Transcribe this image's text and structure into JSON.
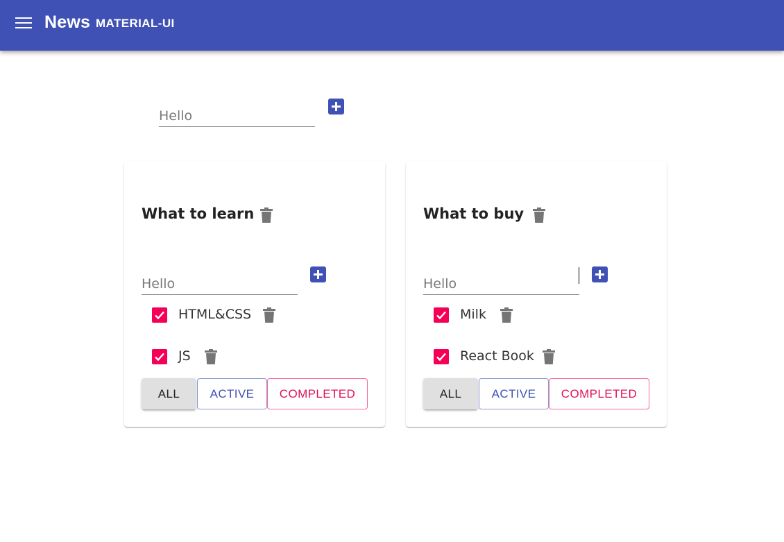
{
  "appbar": {
    "title": "News",
    "subtitle": "MATERIAL-UI",
    "menu_icon": "menu-icon",
    "bg_color": "#3f51b5"
  },
  "new_list": {
    "input_placeholder": "Hello",
    "add_icon": "add-box-icon"
  },
  "lists": [
    {
      "title": "What to learn",
      "input_placeholder": "Hello",
      "tasks": [
        {
          "label": "HTML&CSS",
          "checked": true
        },
        {
          "label": "JS",
          "checked": true
        }
      ],
      "filters": {
        "all": "ALL",
        "active": "ACTIVE",
        "completed": "COMPLETED"
      }
    },
    {
      "title": "What to buy",
      "input_placeholder": "Hello",
      "tasks": [
        {
          "label": "Milk",
          "checked": true
        },
        {
          "label": "React Book",
          "checked": true
        }
      ],
      "filters": {
        "all": "ALL",
        "active": "ACTIVE",
        "completed": "COMPLETED"
      }
    }
  ],
  "colors": {
    "primary": "#3f51b5",
    "secondary": "#f50057",
    "icon_gray": "#757575"
  }
}
